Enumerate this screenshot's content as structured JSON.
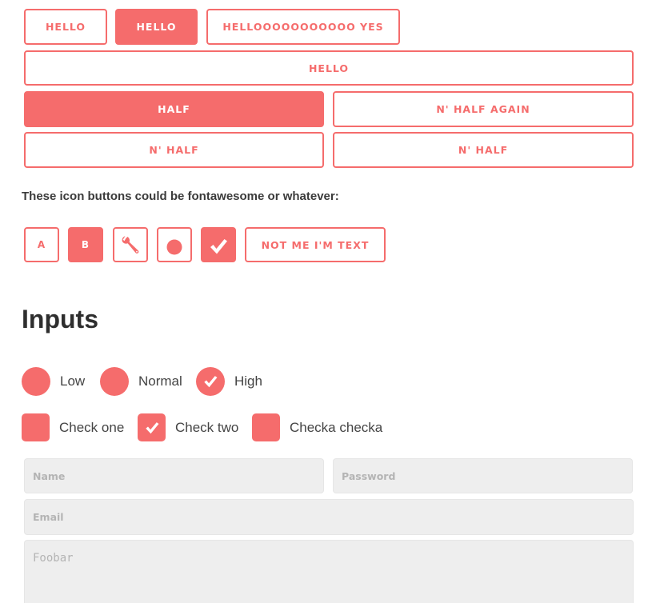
{
  "buttons": {
    "row1": [
      "Hello",
      "Hello",
      "Hellooooooooooo yes"
    ],
    "full": "Hello",
    "half_filled": "Half",
    "half_again": "N' half again",
    "n_half_left": "N' half",
    "n_half_right": "N' half"
  },
  "icon_note": "These icon buttons could be fontawesome or whatever:",
  "icon_buttons": {
    "a": "A",
    "b": "B",
    "icons": [
      "wrench-icon",
      "circle-icon",
      "checkmark-icon"
    ],
    "text": "Not me I'm text"
  },
  "inputs_heading": "Inputs",
  "radios": [
    {
      "label": "Low",
      "checked": false
    },
    {
      "label": "Normal",
      "checked": false
    },
    {
      "label": "High",
      "checked": true
    }
  ],
  "checkboxes": [
    {
      "label": "Check one",
      "checked": false
    },
    {
      "label": "Check two",
      "checked": true
    },
    {
      "label": "Checka checka",
      "checked": false
    }
  ],
  "fields": {
    "name_placeholder": "Name",
    "password_placeholder": "Password",
    "email_placeholder": "Email",
    "textarea_placeholder": "Foobar"
  },
  "colors": {
    "accent": "#f56c6c",
    "field_bg": "#eeeeee",
    "text": "#444444"
  }
}
